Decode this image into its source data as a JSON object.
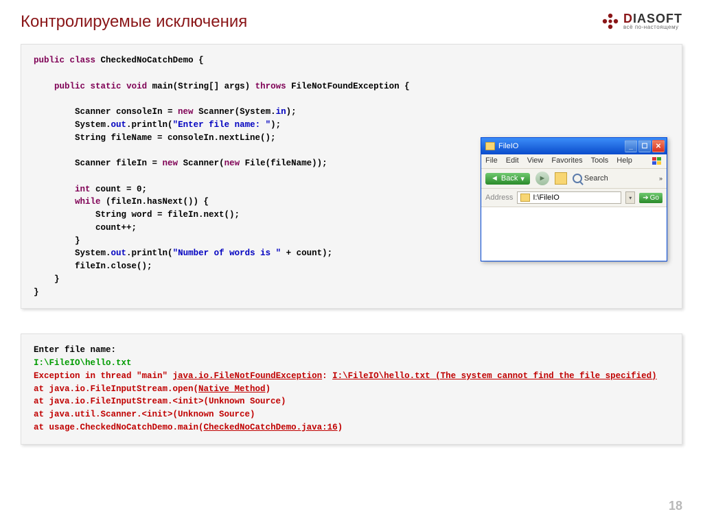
{
  "title": "Контролируемые исключения",
  "logo": {
    "main_pre": "D",
    "main_post": "IASOFT",
    "sub": "всё по-настоящему"
  },
  "page_number": "18",
  "code": {
    "l1_kw1": "public",
    "l1_kw2": "class",
    "l1_txt": " CheckedNoCatchDemo {",
    "l2_kw1": "public",
    "l2_kw2": "static",
    "l2_kw3": "void",
    "l2_txt1": " main(String[] args) ",
    "l2_kw4": "throws",
    "l2_txt2": " FileNotFoundException {",
    "l3_txt1": "Scanner consoleIn = ",
    "l3_kw": "new",
    "l3_txt2": " Scanner(System.",
    "l3_sr": "in",
    "l3_txt3": ");",
    "l4_txt1": "System.",
    "l4_sr": "out",
    "l4_txt2": ".println(",
    "l4_str": "\"Enter file name: \"",
    "l4_txt3": ");",
    "l5_txt": "String fileName = consoleIn.nextLine();",
    "l6_txt1": "Scanner fileIn = ",
    "l6_kw1": "new",
    "l6_txt2": " Scanner(",
    "l6_kw2": "new",
    "l6_txt3": " File(fileName));",
    "l7_kw": "int",
    "l7_txt": " count = 0;",
    "l8_kw": "while",
    "l8_txt": " (fileIn.hasNext()) {",
    "l9_txt": "String word = fileIn.next();",
    "l10_txt": "count++;",
    "l11_txt": "}",
    "l12_txt1": "System.",
    "l12_sr": "out",
    "l12_txt2": ".println(",
    "l12_str": "\"Number of words is \"",
    "l12_txt3": " + count);",
    "l13_txt": "fileIn.close();",
    "l14_txt": "}",
    "l15_txt": "}"
  },
  "output": {
    "prompt": "Enter file name:",
    "input": "I:\\FileIO\\hello.txt",
    "err_pre": "Exception in thread \"main\" ",
    "err_link1": "java.io.FileNotFoundException",
    "err_mid": ": ",
    "err_link2": "I:\\FileIO\\hello.txt (The system cannot find the file specified)",
    "st1_pre": "at java.io.FileInputStream.open(",
    "st1_link": "Native Method",
    "st1_post": ")",
    "st2": "at java.io.FileInputStream.<init>(Unknown Source)",
    "st3": "at java.util.Scanner.<init>(Unknown Source)",
    "st4_pre": "at usage.CheckedNoCatchDemo.main(",
    "st4_link": "CheckedNoCatchDemo.java:16",
    "st4_post": ")"
  },
  "explorer": {
    "title": "FileIO",
    "menu": [
      "File",
      "Edit",
      "View",
      "Favorites",
      "Tools",
      "Help"
    ],
    "back": "Back",
    "search": "Search",
    "address_label": "Address",
    "address_value": "I:\\FileIO",
    "go": "Go"
  }
}
